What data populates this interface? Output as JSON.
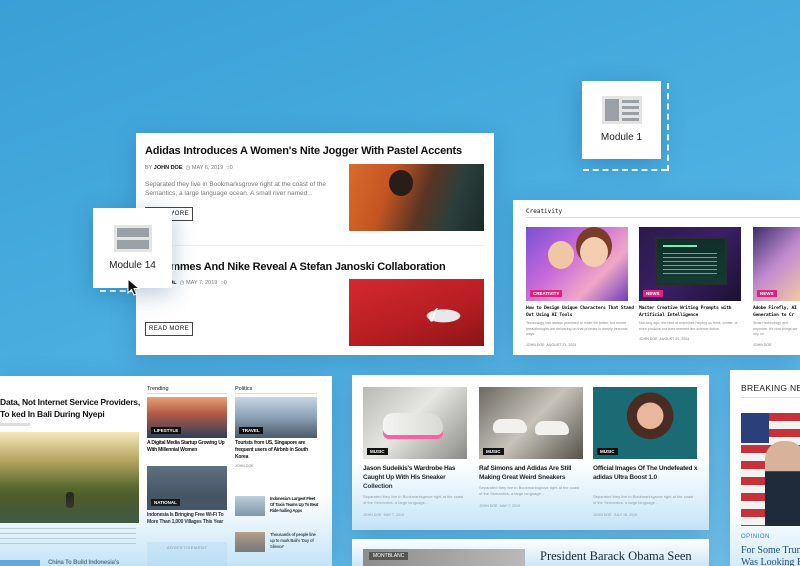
{
  "colors": {
    "background": "#4aaee0",
    "accent_pink": "#e0217e",
    "accent_blue": "#2f7fc1",
    "button_border": "#444444"
  },
  "module1": {
    "label": "Module 1",
    "icon": "module-layout-icon"
  },
  "module14": {
    "label": "Module 14",
    "icon": "module-layout-icon"
  },
  "main_card": {
    "article1": {
      "title": "Adidas Introduces A Women's Nite Jogger With Pastel Accents",
      "by": "BY",
      "author": "JOHN DOE",
      "date": "MAY 6, 2019",
      "comments": "0",
      "excerpt": "Separated they live in Bookmarksgrove right at the coast of the Semantics, a large language ocean. A small river named...",
      "button": "READ MORE"
    },
    "article2": {
      "title": "nt Femmes And Nike Reveal A Stefan Janoski Collaboration",
      "by": "OL",
      "date": "MAY 7, 2019",
      "comments": "0",
      "button": "READ MORE"
    }
  },
  "creativity": {
    "heading": "Creativity",
    "items": [
      {
        "tag": "CREATIVITY",
        "title": "How to Design Unique Characters That Stand Out Using AI Tools",
        "excerpt": "Technology has always promised to make life better, but recent breakthroughs are delivering on that promise in deeply personal ways.",
        "author": "JOHN DOE",
        "date": "AUGUST 21, 2024"
      },
      {
        "tag": "NEWS",
        "title": "Master Creative Writing Prompts with Artificial Intelligence",
        "excerpt": "Not long ago, the idea of machines helping us think, create, or even produce our lives seemed like science fiction.",
        "author": "JOHN DOE",
        "date": "AUGUST 20, 2024"
      },
      {
        "tag": "NEWS",
        "title": "Adobe Firefly, AI Generation to Cr",
        "excerpt": "Smart technology isn't anymore. It's now things we rely on",
        "author": "JOHN DOE",
        "date": ""
      }
    ]
  },
  "left_card": {
    "headline": "Data, Not Internet Service Providers, To ked In Bali During Nyepi",
    "trending_heading": "Trending",
    "politics_heading": "Politics",
    "trending_items": [
      {
        "tag": "LIFESTYLE",
        "title": "A Digital Media Startup Growing Up With Millennial Women"
      },
      {
        "tag": "NATIONAL",
        "title": "Indonesia Is Bringing Free Wi-Fi To More Than 1,000 Villages This Year"
      }
    ],
    "politics_main": {
      "tag": "TRAVEL",
      "title": "Tourists from US, Singapore are frequent users of Airbnb in South Korea",
      "author": "JOHN DOE"
    },
    "politics_small": [
      {
        "title": "Indonesia's Largest Fleet Of Taxis Teams Up To Beat Ride-hailing Apps"
      },
      {
        "title": "Thousands of people line up to mark Bali's 'Day of Silence'"
      }
    ],
    "ad_label": "ADVERTISEMENT",
    "bottom_title": "China To Build Indonesia's"
  },
  "music_card": {
    "items": [
      {
        "tag": "MUSIC",
        "title": "Jason Sudeikis's Wardrobe Has Caught Up With His Sneaker Collection",
        "excerpt": "Separated they live in Bookmarksgrove right at the coast of the Semantics, a large language...",
        "author": "JOHN DOE",
        "date": "MAY 7, 2019"
      },
      {
        "tag": "MUSIC",
        "title": "Raf Simons and Adidas Are Still Making Great Weird Sneakers",
        "excerpt": "Separated they live in Bookmarksgrove right at the coast of the Semantics, a large language...",
        "author": "JOHN DOE",
        "date": "MAY 7, 2019"
      },
      {
        "tag": "MUSIC",
        "title": "Official Images Of The Undefeated x adidas Ultra Boost 1.0",
        "excerpt": "Separated they live in Bookmarksgrove right at the coast of the Semantics, a large language...",
        "author": "JOHN DOE",
        "date": "JULY 18, 2019"
      }
    ]
  },
  "bottom_card": {
    "tag": "MONTBLANC",
    "title": "President Barack Obama Seen"
  },
  "breaking_card": {
    "heading": "BREAKING NEW",
    "category": "OPINION",
    "title": "For Some Trum Was Looking F"
  }
}
